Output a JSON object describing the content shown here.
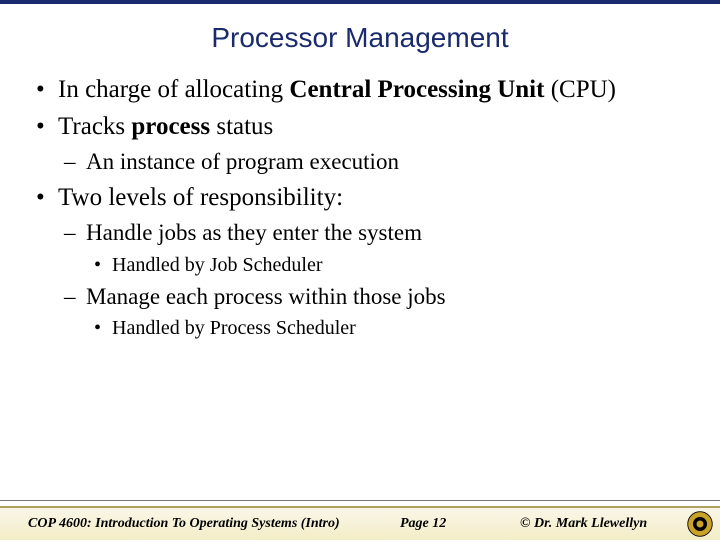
{
  "title": "Processor Management",
  "bullets": {
    "b1_pre": "In charge of allocating ",
    "b1_bold": "Central Processing Unit",
    "b1_post": " (CPU)",
    "b2_pre": "Tracks ",
    "b2_bold": "process",
    "b2_post": " status",
    "b2_sub1": "An instance of program execution",
    "b3": "Two levels of responsibility:",
    "b3_sub1": "Handle jobs as they enter the system",
    "b3_sub1_sub1": "Handled by Job Scheduler",
    "b3_sub2": "Manage each process within those jobs",
    "b3_sub2_sub1": "Handled by Process Scheduler"
  },
  "footer": {
    "course": "COP 4600: Introduction To Operating Systems (Intro)",
    "page": "Page 12",
    "author": "© Dr. Mark Llewellyn"
  },
  "colors": {
    "header_rule": "#1a2a6c",
    "footer_bg": "#f4edc8",
    "footer_border": "#b0a060"
  }
}
